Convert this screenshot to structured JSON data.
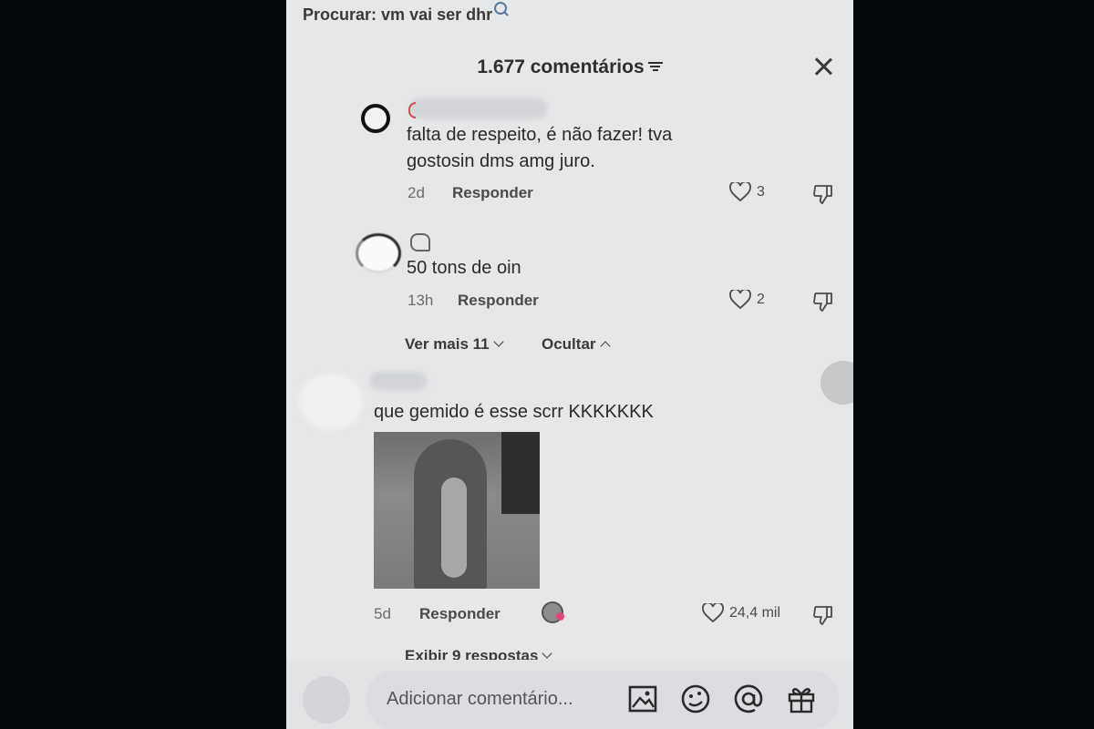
{
  "search": {
    "label": "Procurar:",
    "query": "vm vai ser dhr"
  },
  "header": {
    "title": "1.677 comentários"
  },
  "comments": [
    {
      "text": "falta de respeito, é não fazer! tva gostosin dms amg juro.",
      "time": "2d",
      "reply_label": "Responder",
      "likes": "3"
    },
    {
      "text": "50 tons de oin",
      "time": "13h",
      "reply_label": "Responder",
      "likes": "2"
    },
    {
      "text": "que gemido é esse scrr KKKKKKK",
      "time": "5d",
      "reply_label": "Responder",
      "likes": "24,4 mil"
    }
  ],
  "thread_controls": {
    "more": "Ver mais 11",
    "hide": "Ocultar"
  },
  "replies_link": "Exibir 9 respostas",
  "input": {
    "placeholder": "Adicionar comentário..."
  },
  "icons": [
    "search-icon",
    "filter-icon",
    "close-icon",
    "heart-icon",
    "dislike-icon",
    "image-icon",
    "emoji-icon",
    "at-icon",
    "gift-icon"
  ]
}
